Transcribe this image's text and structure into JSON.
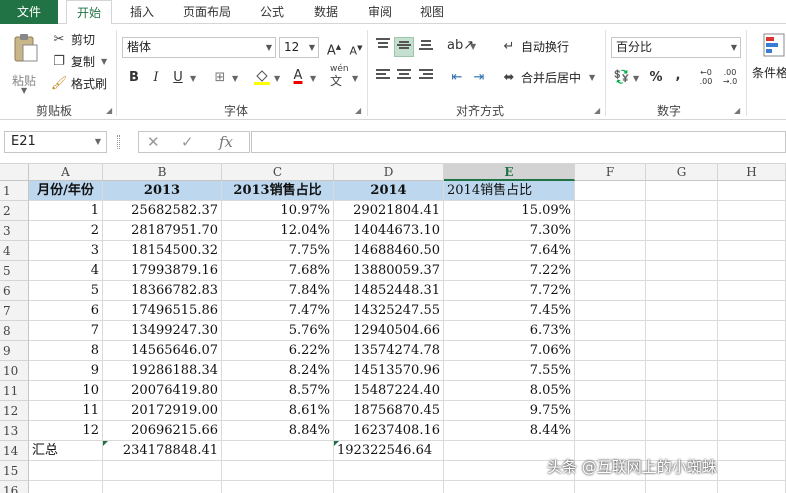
{
  "tabs": [
    "文件",
    "开始",
    "插入",
    "页面布局",
    "公式",
    "数据",
    "审阅",
    "视图"
  ],
  "clipboard": {
    "paste_label": "粘贴",
    "cut_label": "剪切",
    "copy_label": "复制",
    "format_painter_label": "格式刷",
    "group_label": "剪贴板"
  },
  "font": {
    "font_name": "楷体",
    "font_size": "12",
    "bold": "B",
    "italic": "I",
    "underline": "U",
    "font_color_glyph": "A",
    "wen_glyph": "wén",
    "group_label": "字体"
  },
  "alignment": {
    "wrap_text_label": "自动换行",
    "merge_center_label": "合并后居中",
    "group_label": "对齐方式"
  },
  "number": {
    "format": "百分比",
    "percent": "%",
    "comma": ",",
    "group_label": "数字"
  },
  "styles": {
    "cond_format_label": "条件格"
  },
  "formula_bar": {
    "name_box": "E21",
    "fx": "fx"
  },
  "columns": [
    "A",
    "B",
    "C",
    "D",
    "E",
    "F",
    "G",
    "H"
  ],
  "rows": [
    "1",
    "2",
    "3",
    "4",
    "5",
    "6",
    "7",
    "8",
    "9",
    "10",
    "11",
    "12",
    "13",
    "14",
    "15",
    "16"
  ],
  "header_row": [
    "月份/年份",
    "2013",
    "2013销售占比",
    "2014",
    "2014销售占比"
  ],
  "data_rows": [
    [
      "1",
      "25682582.37",
      "10.97%",
      "29021804.41",
      "15.09%"
    ],
    [
      "2",
      "28187951.70",
      "12.04%",
      "14044673.10",
      "7.30%"
    ],
    [
      "3",
      "18154500.32",
      "7.75%",
      "14688460.50",
      "7.64%"
    ],
    [
      "4",
      "17993879.16",
      "7.68%",
      "13880059.37",
      "7.22%"
    ],
    [
      "5",
      "18366782.83",
      "7.84%",
      "14852448.31",
      "7.72%"
    ],
    [
      "6",
      "17496515.86",
      "7.47%",
      "14325247.55",
      "7.45%"
    ],
    [
      "7",
      "13499247.30",
      "5.76%",
      "12940504.66",
      "6.73%"
    ],
    [
      "8",
      "14565646.07",
      "6.22%",
      "13574274.78",
      "7.06%"
    ],
    [
      "9",
      "19286188.34",
      "8.24%",
      "14513570.96",
      "7.55%"
    ],
    [
      "10",
      "20076419.80",
      "8.57%",
      "15487224.40",
      "8.05%"
    ],
    [
      "11",
      "20172919.00",
      "8.61%",
      "18756870.45",
      "9.75%"
    ],
    [
      "12",
      "20696215.66",
      "8.84%",
      "16237408.16",
      "8.44%"
    ]
  ],
  "total_row": [
    "汇总",
    "234178848.41",
    "",
    "192322546.64",
    ""
  ],
  "watermark": "头条 @互联网上的小蜘蛛",
  "colors": {
    "accent": "#217346",
    "header_fill": "#bdd7ee"
  }
}
